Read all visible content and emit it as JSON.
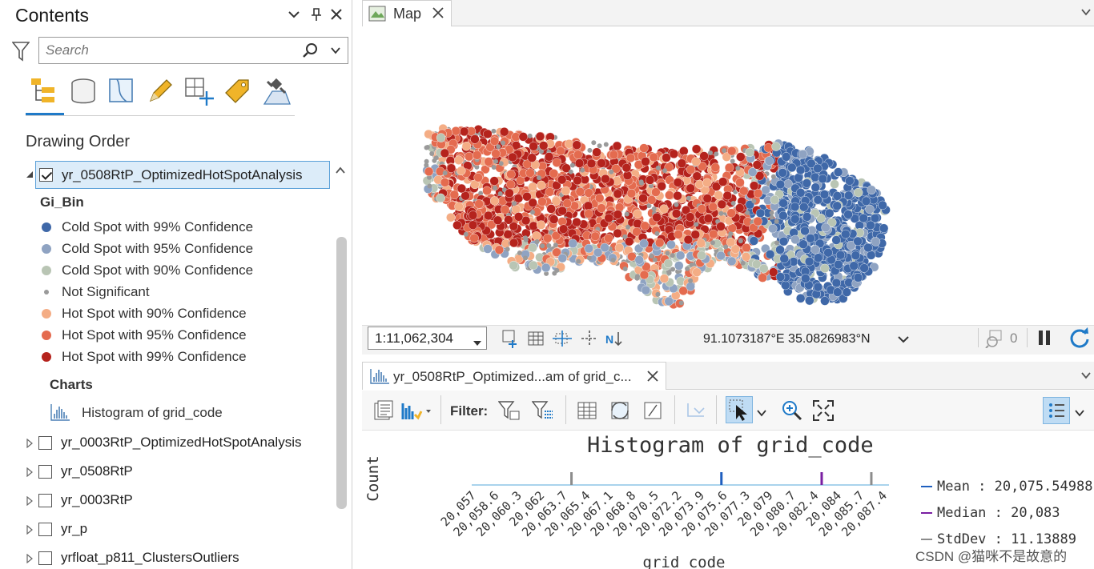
{
  "contents": {
    "title": "Contents",
    "search_placeholder": "Search",
    "drawing_order_label": "Drawing Order",
    "selected_layer": "yr_0508RtP_OptimizedHotSpotAnalysis",
    "symbology_field": "Gi_Bin",
    "legend": [
      {
        "label": "Cold Spot with 99% Confidence",
        "color": "#3f68a8"
      },
      {
        "label": "Cold Spot with 95% Confidence",
        "color": "#8fa3c2"
      },
      {
        "label": "Cold Spot with 90% Confidence",
        "color": "#b9c5b4"
      },
      {
        "label": "Not Significant",
        "color": "#9a9a9a"
      },
      {
        "label": "Hot Spot with 90% Confidence",
        "color": "#f4ad85"
      },
      {
        "label": "Hot Spot with 95% Confidence",
        "color": "#e46b4f"
      },
      {
        "label": "Hot Spot with 99% Confidence",
        "color": "#b5231d"
      }
    ],
    "charts_label": "Charts",
    "chart_item": "Histogram of grid_code",
    "other_layers": [
      "yr_0003RtP_OptimizedHotSpotAnalysis",
      "yr_0508RtP",
      "yr_0003RtP",
      "yr_p",
      "yrfloat_p811_ClustersOutliers"
    ]
  },
  "map": {
    "tab_label": "Map",
    "scale": "1:11,062,304",
    "coordinates": "91.1073187°E 35.0826983°N",
    "selection_count": "0"
  },
  "chart_pane": {
    "tab_label": "yr_0508RtP_Optimized...am of grid_c...",
    "filter_label": "Filter:"
  },
  "chart_data": {
    "type": "bar",
    "title": "Histogram of grid_code",
    "xlabel": "grid_code",
    "ylabel": "Count",
    "tick_labels": [
      "20,057",
      "20,058.6",
      "20,060.3",
      "20,062",
      "20,063.7",
      "20,065.4",
      "20,067.1",
      "20,068.8",
      "20,070.5",
      "20,072.2",
      "20,073.9",
      "20,075.6",
      "20,077.3",
      "20,079",
      "20,080.7",
      "20,082.4",
      "20,084",
      "20,085.7",
      "20,087.4"
    ],
    "xlim": [
      20057,
      20088
    ],
    "stats": {
      "mean": "Mean : 20,075.54988",
      "median": "Median : 20,083",
      "stddev": "StdDev : 11.13889"
    },
    "mean_value": 20075.54988,
    "median_value": 20083,
    "stddev_lines": [
      20064.41099,
      20086.68877
    ],
    "colors": {
      "bars": "#a9d3ec",
      "mean": "#1f5fbf",
      "median": "#7a1fa2",
      "stddev": "#8c8c8c"
    }
  },
  "watermark": "CSDN @猫咪不是故意的"
}
